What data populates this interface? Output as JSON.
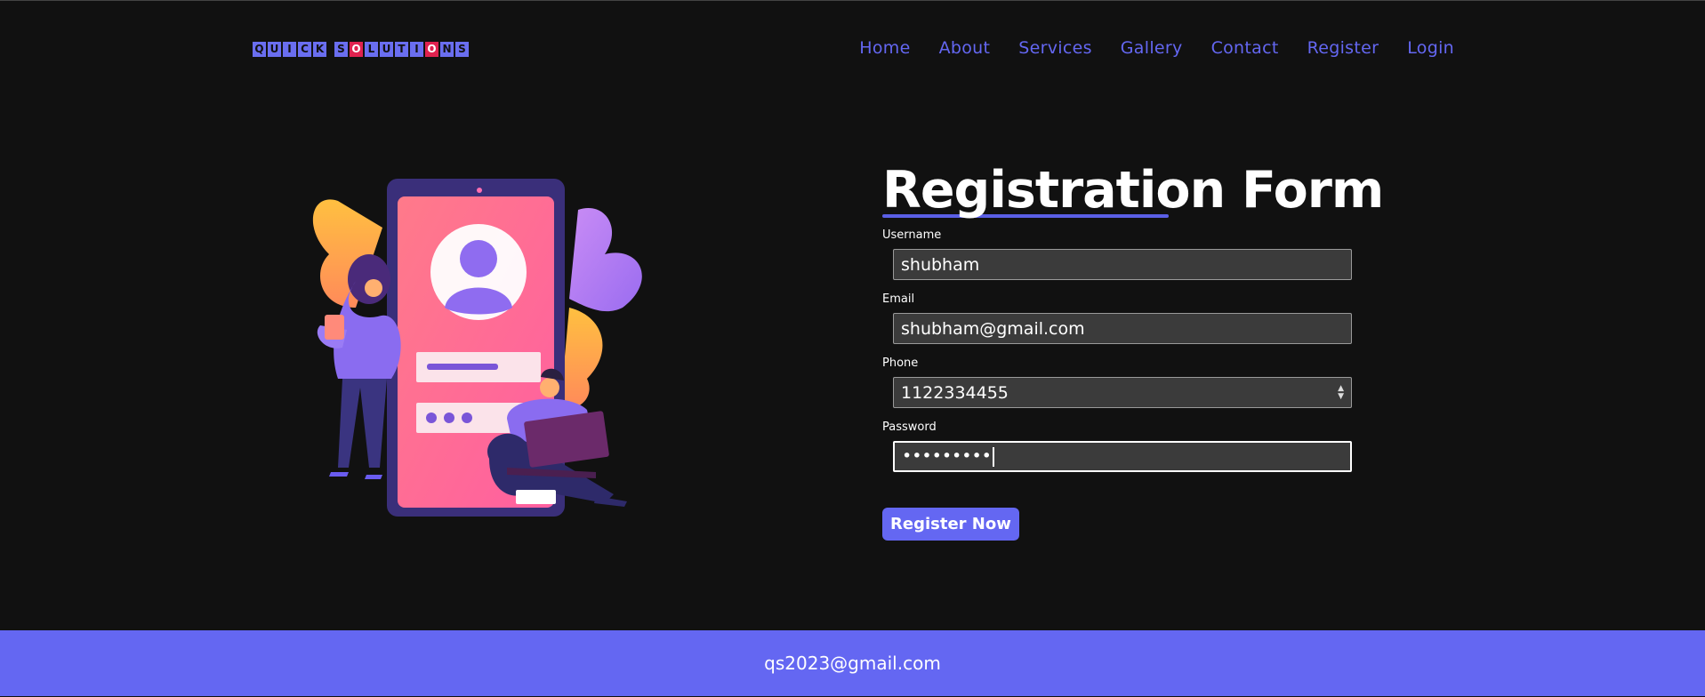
{
  "header": {
    "logo_letters": [
      "Q",
      "U",
      "I",
      "C",
      "K",
      " ",
      "S",
      "O",
      "L",
      "U",
      "T",
      "I",
      "O",
      "N",
      "S"
    ],
    "logo_text": "QUICK SOLUTIONS",
    "nav": [
      "Home",
      "About",
      "Services",
      "Gallery",
      "Contact",
      "Register",
      "Login"
    ]
  },
  "form": {
    "title": "Registration Form",
    "username_label": "Username",
    "username_value": "shubham",
    "email_label": "Email",
    "email_value": "shubham@gmail.com",
    "phone_label": "Phone",
    "phone_value": "1122334455",
    "password_label": "Password",
    "password_value": "•••••••••",
    "submit_label": "Register Now"
  },
  "footer": {
    "email": "qs2023@gmail.com"
  },
  "colors": {
    "background": "#111111",
    "accent": "#6467f2",
    "logo_highlight": "#e0224f"
  },
  "icons": {
    "phone_stepper": "stepper-icon",
    "illustration": "registration-illustration"
  }
}
